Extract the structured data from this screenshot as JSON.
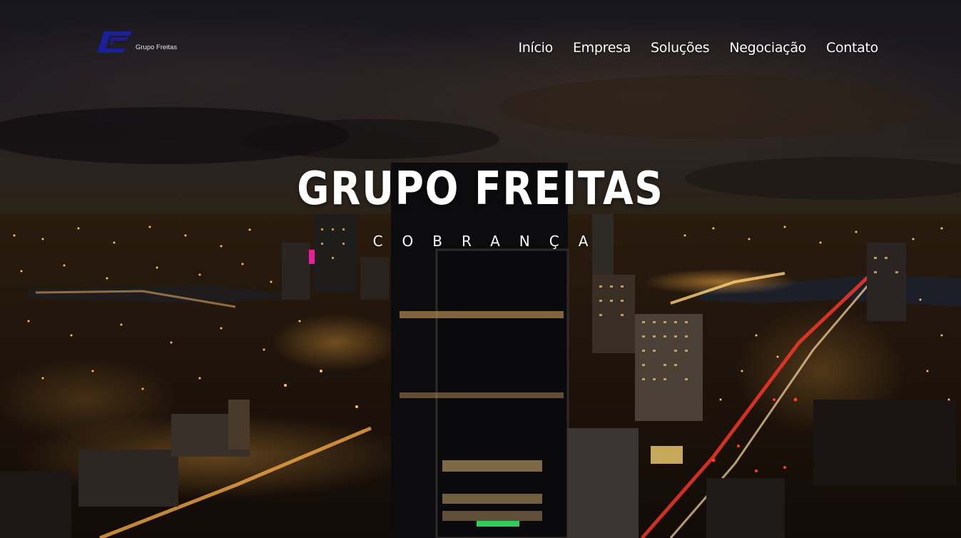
{
  "brand": {
    "logo_text": "Grupo Freitas",
    "logo_icon": "grupo-freitas-logo-icon",
    "logo_color": "#1c1f9c"
  },
  "nav": {
    "items": [
      {
        "label": "Início"
      },
      {
        "label": "Empresa"
      },
      {
        "label": "Soluções"
      },
      {
        "label": "Negociação"
      },
      {
        "label": "Contato"
      }
    ]
  },
  "hero": {
    "title": "GRUPO FREITAS",
    "subtitle": "COBRANÇA",
    "background": "night-city-skyline-photo"
  },
  "colors": {
    "text": "#ffffff",
    "sky": "#17161e",
    "city_light": "#f5a030"
  }
}
